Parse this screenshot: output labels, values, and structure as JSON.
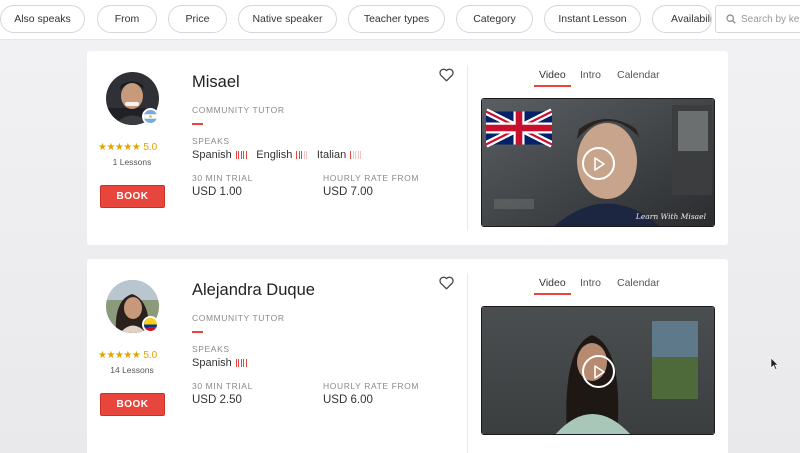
{
  "filters": [
    {
      "label": "Also speaks"
    },
    {
      "label": "From"
    },
    {
      "label": "Price"
    },
    {
      "label": "Native speaker"
    },
    {
      "label": "Teacher types"
    },
    {
      "label": "Category"
    },
    {
      "label": "Instant Lesson"
    },
    {
      "label": "Availabili"
    }
  ],
  "search": {
    "placeholder": "Search by ke"
  },
  "colors": {
    "accent": "#e8453c",
    "star": "#e2a400"
  },
  "tutors": [
    {
      "name": "Misael",
      "type": "COMMUNITY TUTOR",
      "rating": "5.0",
      "stars": "★★★★★",
      "lessons": "1 Lessons",
      "book_label": "BOOK",
      "speaks_label": "SPEAKS",
      "languages": [
        {
          "name": "Spanish",
          "level": 5
        },
        {
          "name": "English",
          "level": 3
        },
        {
          "name": "Italian",
          "level": 1
        }
      ],
      "trial_label": "30 MIN TRIAL",
      "trial_price": "USD 1.00",
      "rate_label": "HOURLY RATE FROM",
      "rate_price": "USD 7.00",
      "flag": "argentina",
      "tabs": [
        "Video",
        "Intro",
        "Calendar"
      ],
      "video_watermark": "Learn With Misael",
      "favorite_icon": "heart-outline-icon"
    },
    {
      "name": "Alejandra Duque",
      "type": "COMMUNITY TUTOR",
      "rating": "5.0",
      "stars": "★★★★★",
      "lessons": "14 Lessons",
      "book_label": "BOOK",
      "speaks_label": "SPEAKS",
      "languages": [
        {
          "name": "Spanish",
          "level": 5
        }
      ],
      "trial_label": "30 MIN TRIAL",
      "trial_price": "USD 2.50",
      "rate_label": "HOURLY RATE FROM",
      "rate_price": "USD 6.00",
      "flag": "colombia",
      "tabs": [
        "Video",
        "Intro",
        "Calendar"
      ],
      "favorite_icon": "heart-outline-icon"
    }
  ]
}
